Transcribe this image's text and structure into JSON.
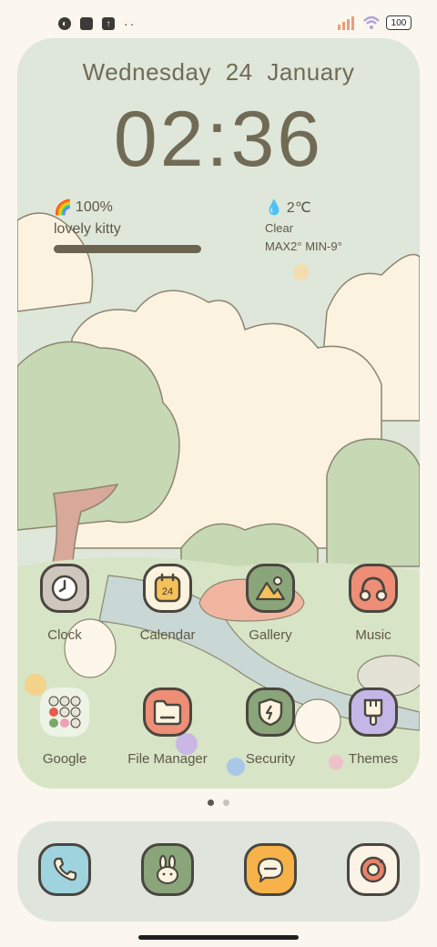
{
  "status_bar": {
    "left_icons": [
      "notification-icon",
      "square-notification-icon",
      "upload-icon"
    ],
    "more_dots": "··",
    "battery_level": "100"
  },
  "widget": {
    "date": "Wednesday  24  January",
    "time": "02:36",
    "battery": {
      "emoji": "🌈",
      "percent": "100%",
      "name": "lovely kitty",
      "level": 1.0
    },
    "weather": {
      "emoji": "💧",
      "temp": "2℃",
      "condition": "Clear",
      "range": "MAX2° MIN-9°"
    }
  },
  "apps_row1": [
    {
      "label": "Clock",
      "icon": "clock-icon",
      "color": "#cfc7bd"
    },
    {
      "label": "Calendar",
      "icon": "calendar-icon",
      "color": "#fbf3dd",
      "badge": "24"
    },
    {
      "label": "Gallery",
      "icon": "gallery-icon",
      "color": "#8aa57a"
    },
    {
      "label": "Music",
      "icon": "headphones-icon",
      "color": "#ee8e76"
    }
  ],
  "apps_row2": [
    {
      "label": "Google",
      "icon": "google-folder-icon"
    },
    {
      "label": "File Manager",
      "icon": "folder-icon",
      "color": "#ee8e76"
    },
    {
      "label": "Security",
      "icon": "shield-icon",
      "color": "#8aa57a"
    },
    {
      "label": "Themes",
      "icon": "brush-icon",
      "color": "#c4b7e8"
    }
  ],
  "pager": {
    "pages": 2,
    "current": 1
  },
  "dock": [
    {
      "icon": "phone-icon",
      "color": "#9fd3dd"
    },
    {
      "icon": "bunny-icon",
      "color": "#8aa57a"
    },
    {
      "icon": "message-icon",
      "color": "#f7b24a"
    },
    {
      "icon": "camera-icon",
      "color": "#fbf3e6"
    }
  ]
}
